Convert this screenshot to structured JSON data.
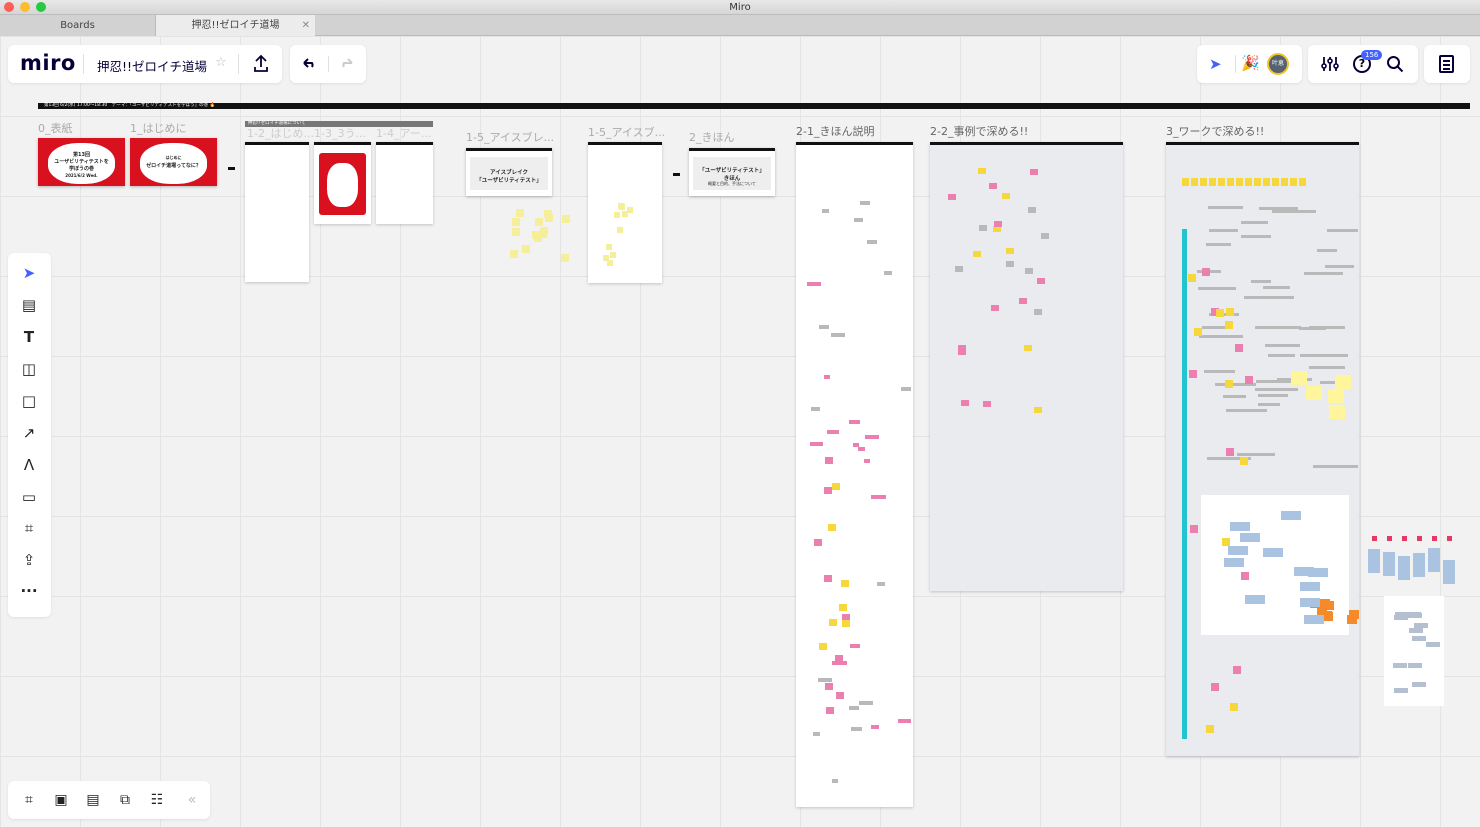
{
  "window": {
    "title": "Miro"
  },
  "tabs": [
    {
      "label": "Boards"
    },
    {
      "label": "押忍!!ゼロイチ道場",
      "active": true
    }
  ],
  "header": {
    "logo": "miro",
    "board_name": "押忍!!ゼロイチ道場",
    "avatar_initials": "叶恵",
    "notification_count": "156"
  },
  "colors": {
    "accent": "#4262ff",
    "brand_red": "#d9101e",
    "sticky_yellow": "#f7d83c",
    "sticky_pink": "#ea7fb0",
    "teal": "#23c4cf"
  },
  "banner": {
    "text": "第13回 6/2(水) 17:00〜18:30　テーマ：「ユーザビリティテストを学ぼう」の巻 🔥"
  },
  "frames": {
    "cover": {
      "label": "0_表紙",
      "line1": "第13回",
      "line2": "ユーザビリティテストを",
      "line3": "学ぼうの巻",
      "date": "2021/6/2 Wed."
    },
    "intro": {
      "label": "1_はじめに",
      "line1": "はじめに",
      "line2": "ゼロイチ道場ってなに？"
    },
    "group_header": "押忍!!ゼロイチ道場について",
    "f12": {
      "label": "1-2_はじめ..."
    },
    "f13": {
      "label": "1-3_3う..."
    },
    "f14": {
      "label": "1-4_アー..."
    },
    "f15a": {
      "label": "1-5_アイスブレ...",
      "line1": "アイスブレイク",
      "line2": "「ユーザビリティテスト」"
    },
    "f15b": {
      "label": "1-5_アイスブ..."
    },
    "basics": {
      "label": "2_きほん",
      "line1": "「ユーザビリティテスト」",
      "line2": "きほん",
      "line3": "概要と目的、手法について"
    },
    "f21": {
      "label": "2-1_きほん説明"
    },
    "f22": {
      "label": "2-2_事例で深める!!"
    },
    "f3": {
      "label": "3_ワークで深める!!"
    }
  },
  "toolbar_left": [
    {
      "icon": "select-cursor-icon"
    },
    {
      "icon": "templates-icon"
    },
    {
      "icon": "text-icon"
    },
    {
      "icon": "sticky-note-icon"
    },
    {
      "icon": "shape-icon"
    },
    {
      "icon": "connection-line-icon"
    },
    {
      "icon": "pen-icon"
    },
    {
      "icon": "comment-icon"
    },
    {
      "icon": "frame-icon"
    },
    {
      "icon": "upload-icon"
    },
    {
      "icon": "more-icon"
    }
  ],
  "toolbar_bottom": [
    {
      "icon": "frames-icon"
    },
    {
      "icon": "presentation-icon"
    },
    {
      "icon": "comments-icon"
    },
    {
      "icon": "screen-share-icon"
    },
    {
      "icon": "card-list-icon"
    },
    {
      "icon": "collapse-icon"
    }
  ]
}
